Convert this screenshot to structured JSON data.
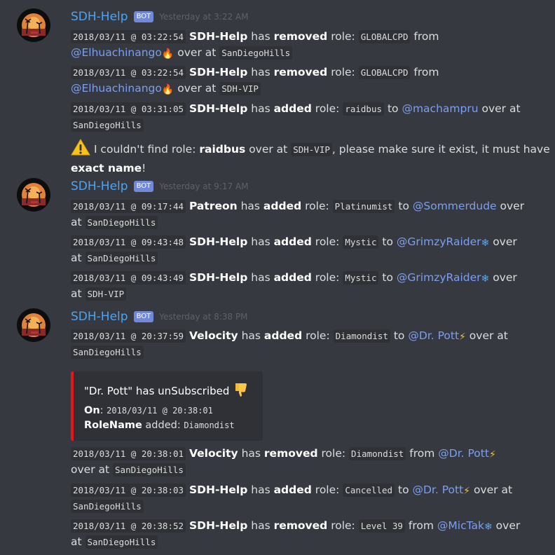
{
  "colors": {
    "background": "#36393f",
    "username": "#4ea4f0",
    "mention": "#7c9ff0",
    "bot_badge": "#7289da",
    "embed_border": "#e5171b"
  },
  "groups": [
    {
      "username": "SDH-Help",
      "badge": "BOT",
      "timestamp": "Yesterday at 3:22 AM",
      "lines": [
        {
          "stamp": "2018/03/11 @ 03:22:54",
          "actor": "SDH-Help",
          "has": "has",
          "action": "removed",
          "role_word": "role:",
          "role": "GLOBALCPD",
          "prep": "from",
          "mention": "@Elhuachinango",
          "emoji": "fire",
          "over": "over at",
          "server": "SanDiegoHills"
        },
        {
          "stamp": "2018/03/11 @ 03:22:54",
          "actor": "SDH-Help",
          "has": "has",
          "action": "removed",
          "role_word": "role:",
          "role": "GLOBALCPD",
          "prep": "from",
          "mention": "@Elhuachinango",
          "emoji": "fire",
          "over": "over at",
          "server": "SDH-VIP"
        },
        {
          "stamp": "2018/03/11 @ 03:31:05",
          "actor": "SDH-Help",
          "has": "has",
          "action": "added",
          "role_word": "role:",
          "role": "raidbus",
          "prep": "to",
          "mention": "@machampru",
          "over": "over at",
          "server": "SanDiegoHills"
        }
      ],
      "warning": {
        "icon": "warning-icon",
        "t1": "I couldn't find role:",
        "role": "raidbus",
        "t2": "over at",
        "server": "SDH-VIP",
        "t3": ", please make sure it exist, it must have",
        "t4": "exact name",
        "t5": "!"
      }
    },
    {
      "username": "SDH-Help",
      "badge": "BOT",
      "timestamp": "Yesterday at 9:17 AM",
      "lines": [
        {
          "stamp": "2018/03/11 @ 09:17:44",
          "actor": "Patreon",
          "has": "has",
          "action": "added",
          "role_word": "role:",
          "role": "Platinumist",
          "prep": "to",
          "mention": "@Sommerdude",
          "over": "over",
          "over2": "at",
          "server": "SanDiegoHills"
        },
        {
          "stamp": "2018/03/11 @ 09:43:48",
          "actor": "SDH-Help",
          "has": "has",
          "action": "added",
          "role_word": "role:",
          "role": "Mystic",
          "prep": "to",
          "mention": "@GrimzyRaider",
          "emoji": "snowflake",
          "over": "over",
          "over2": "at",
          "server": "SanDiegoHills"
        },
        {
          "stamp": "2018/03/11 @ 09:43:49",
          "actor": "SDH-Help",
          "has": "has",
          "action": "added",
          "role_word": "role:",
          "role": "Mystic",
          "prep": "to",
          "mention": "@GrimzyRaider",
          "emoji": "snowflake",
          "over": "over",
          "over2": "at",
          "server": "SDH-VIP"
        }
      ]
    },
    {
      "username": "SDH-Help",
      "badge": "BOT",
      "timestamp": "Yesterday at 8:38 PM",
      "lines": [
        {
          "stamp": "2018/03/11 @ 20:37:59",
          "actor": "Velocity",
          "has": "has",
          "action": "added",
          "role_word": "role:",
          "role": "Diamondist",
          "prep": "to",
          "mention": "@Dr. Pott",
          "emoji": "zap",
          "over": "over at",
          "server": "SanDiegoHills"
        },
        {
          "stamp": "2018/03/11 @ 20:38:01",
          "actor": "Velocity",
          "has": "has",
          "action": "removed",
          "role_word": "role:",
          "role": "Diamondist",
          "prep": "from",
          "mention": "@Dr. Pott",
          "emoji": "zap",
          "over": "over at",
          "server": "SanDiegoHills"
        },
        {
          "stamp": "2018/03/11 @ 20:38:03",
          "actor": "SDH-Help",
          "has": "has",
          "action": "added",
          "role_word": "role:",
          "role": "Cancelled",
          "prep": "to",
          "mention": "@Dr. Pott",
          "emoji": "zap",
          "over": "over at",
          "server": "SanDiegoHills"
        },
        {
          "stamp": "2018/03/11 @ 20:38:52",
          "actor": "SDH-Help",
          "has": "has",
          "action": "removed",
          "role_word": "role:",
          "role": "Level 39",
          "prep": "from",
          "mention": "@MicTak",
          "emoji": "snowflake",
          "over": "over",
          "over2": "at",
          "server": "SanDiegoHills"
        }
      ],
      "embed": {
        "title": "\"Dr. Pott\" has unSubscribed",
        "title_icon": "thumbs-down-icon",
        "on_label": "On",
        "on_colon": ":",
        "on_value": "2018/03/11 @ 20:38:01",
        "rolename_label": "RoleName",
        "rolename_text": "added:",
        "rolename_value": "Diamondist"
      }
    }
  ]
}
